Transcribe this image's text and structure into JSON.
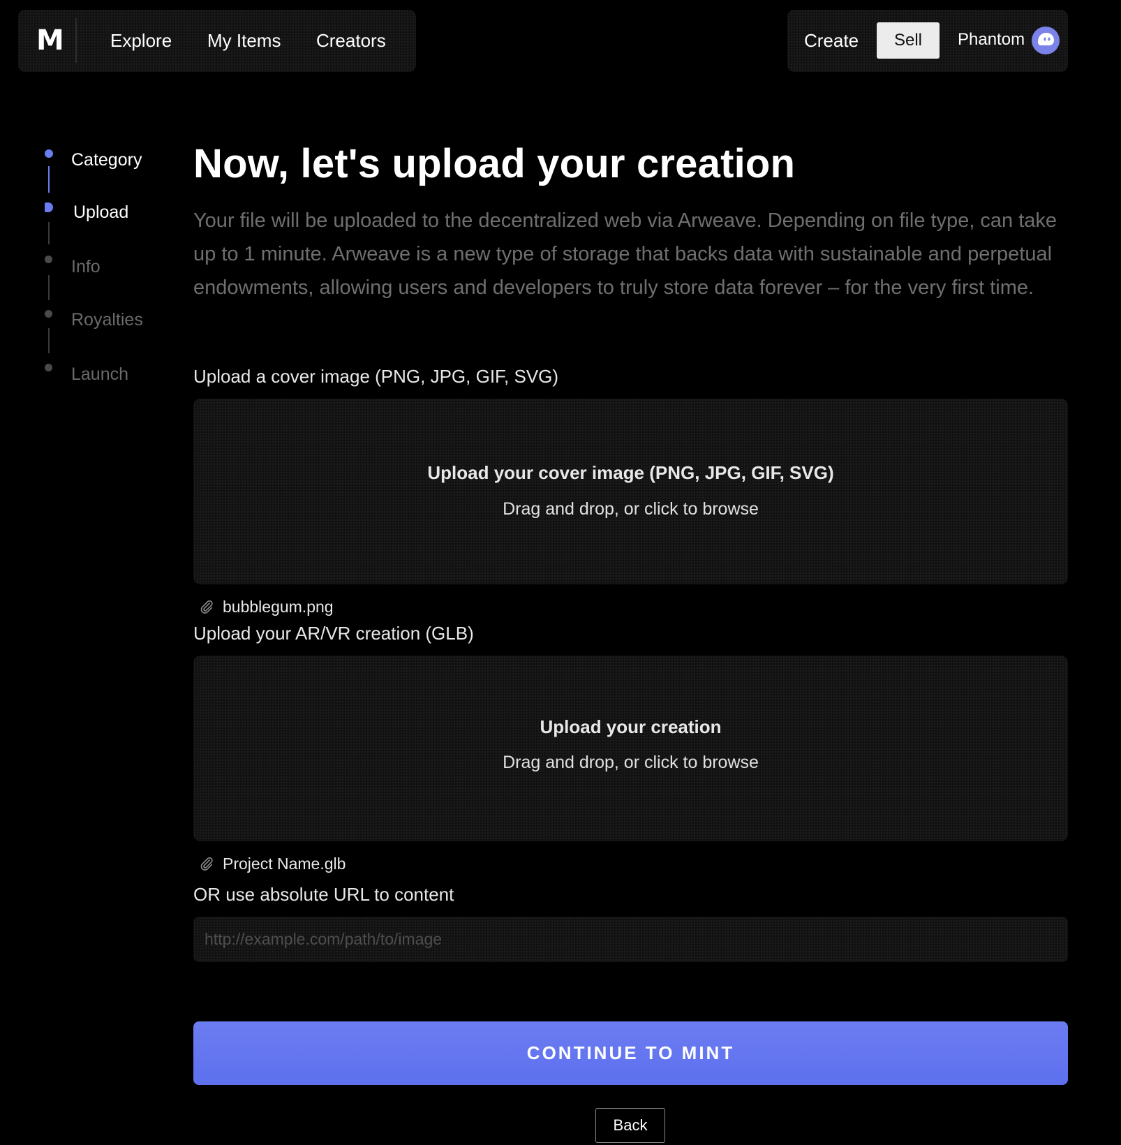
{
  "header": {
    "logo": "M",
    "nav": [
      {
        "label": "Explore"
      },
      {
        "label": "My Items"
      },
      {
        "label": "Creators"
      }
    ],
    "create_label": "Create",
    "sell_label": "Sell",
    "wallet_label": "Phantom",
    "wallet_icon": "phantom-ghost-icon"
  },
  "stepper": {
    "steps": [
      {
        "label": "Category",
        "state": "completed"
      },
      {
        "label": "Upload",
        "state": "active"
      },
      {
        "label": "Info",
        "state": "pending"
      },
      {
        "label": "Royalties",
        "state": "pending"
      },
      {
        "label": "Launch",
        "state": "pending"
      }
    ]
  },
  "main": {
    "title": "Now, let's upload your creation",
    "description": "Your file will be uploaded to the decentralized web via Arweave. Depending on file type, can take up to 1 minute. Arweave is a new type of storage that backs data with sustainable and perpetual endowments, allowing users and developers to truly store data forever – for the very first time.",
    "cover": {
      "label": "Upload a cover image (PNG, JPG, GIF, SVG)",
      "dropzone_title": "Upload your cover image (PNG, JPG, GIF, SVG)",
      "dropzone_sub": "Drag and drop, or click to browse",
      "file_name": "bubblegum.png",
      "file_icon": "paperclip-icon"
    },
    "creation": {
      "label": "Upload your AR/VR creation (GLB)",
      "dropzone_title": "Upload your creation",
      "dropzone_sub": "Drag and drop, or click to browse",
      "file_name": "Project Name.glb",
      "file_icon": "paperclip-icon"
    },
    "url": {
      "label": "OR use absolute URL to content",
      "placeholder": "http://example.com/path/to/image",
      "value": ""
    },
    "continue_label": "CONTINUE TO MINT",
    "back_label": "Back"
  },
  "colors": {
    "accent": "#6b7cf0",
    "background": "#000000",
    "panel": "#121212",
    "muted_text": "#6f6f6f"
  }
}
